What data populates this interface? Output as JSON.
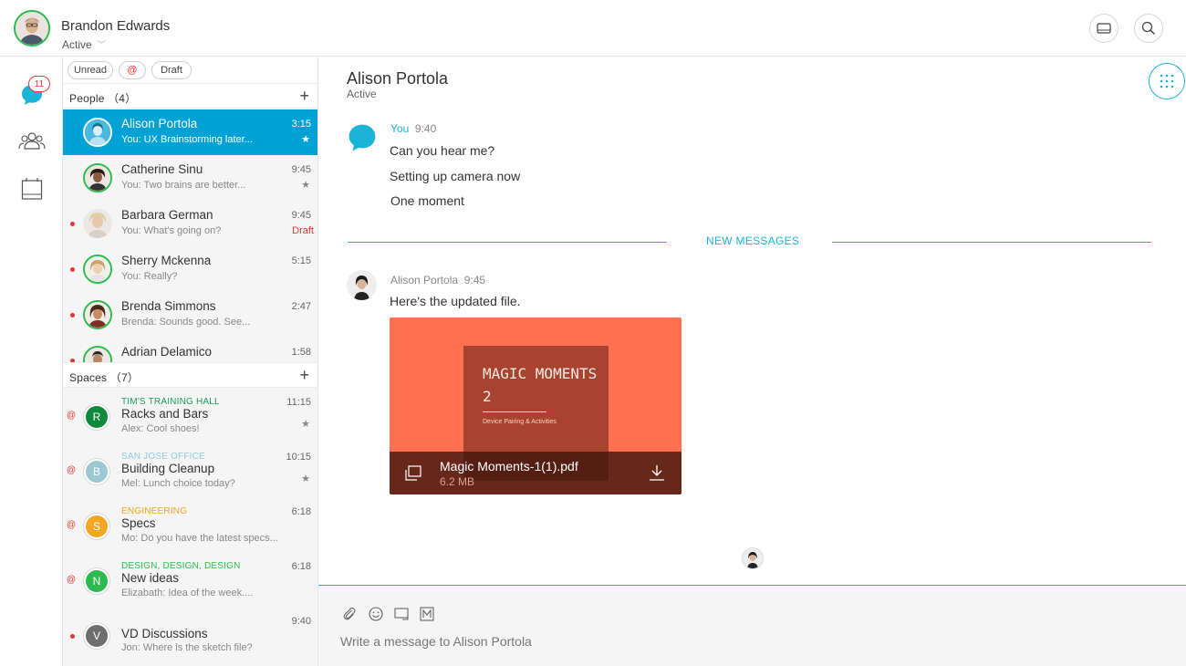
{
  "user": {
    "name": "Brandon Edwards",
    "status": "Active"
  },
  "rail": {
    "unread_badge": "11"
  },
  "filters": {
    "unread": "Unread",
    "mention": "@",
    "draft": "Draft"
  },
  "people": {
    "header": "People （4）",
    "items": [
      {
        "name": "Alison Portola",
        "preview": "You: UX Brainstorming later...",
        "time": "3:15",
        "starred": "★"
      },
      {
        "name": "Catherine Sinu",
        "preview": "You: Two brains are better...",
        "time": "9:45",
        "starred": "★"
      },
      {
        "name": "Barbara German",
        "preview": "You: What's going on?",
        "time": "9:45",
        "draft": "Draft"
      },
      {
        "name": "Sherry Mckenna",
        "preview": "You: Really?",
        "time": "5:15"
      },
      {
        "name": "Brenda Simmons",
        "preview": "Brenda: Sounds good. See...",
        "time": "2:47"
      },
      {
        "name": "Adrian Delamico",
        "preview": "",
        "time": "1:58"
      }
    ]
  },
  "spaces": {
    "header": "Spaces （7）",
    "items": [
      {
        "team": "TIM'S TRAINING HALL",
        "team_color": "#1b9e55",
        "name": "Racks and Bars",
        "preview": "Alex: Cool shoes!",
        "time": "11:15",
        "letter": "R",
        "letter_color": "#0f8a3c",
        "starred": "★",
        "mention": "@"
      },
      {
        "team": "SAN JOSE OFFICE",
        "team_color": "#8fc9d6",
        "name": "Building Cleanup",
        "preview": "Mel: Lunch choice today?",
        "time": "10:15",
        "letter": "B",
        "letter_color": "#9cc8d4",
        "starred": "★",
        "mention": "@"
      },
      {
        "team": "ENGINEERING",
        "team_color": "#f2a51a",
        "name": "Specs",
        "preview": "Mo: Do you have the latest specs...",
        "time": "6:18",
        "letter": "S",
        "letter_color": "#f5a623",
        "mention": "@"
      },
      {
        "team": "DESIGN, DESIGN, DESIGN",
        "team_color": "#2dbb4f",
        "name": "New ideas",
        "preview": "Elizabath: Idea of the week....",
        "time": "6:18",
        "letter": "N",
        "letter_color": "#2dbb4f",
        "mention": "@"
      },
      {
        "team": "",
        "team_color": "#333333",
        "name": "VD Discussions",
        "preview": "Jon: Where is the sketch file?",
        "time": "9:40",
        "letter": "V",
        "letter_color": "#6e6e6e"
      }
    ]
  },
  "chat": {
    "title": "Alison Portola",
    "status": "Active",
    "my_sender": "You",
    "my_time": "9:40",
    "my_messages": [
      "Can you hear me?",
      "Setting up camera now",
      "One moment"
    ],
    "new_messages_label": "NEW MESSAGES",
    "their_sender": "Alison Portola",
    "their_time": "9:45",
    "their_message": "Here's the updated file.",
    "file": {
      "preview_title": "MAGIC MOMENTS 2",
      "preview_subtitle": "Device Pairing & Activities",
      "name": "Magic Moments-1(1).pdf",
      "size": "6.2 MB"
    }
  },
  "composer": {
    "placeholder": "Write a message to Alison Portola"
  },
  "colors": {
    "accent": "#00a2d6",
    "presence": "#2dbb4f",
    "alert": "#e33333",
    "file_card": "#ff7051"
  }
}
